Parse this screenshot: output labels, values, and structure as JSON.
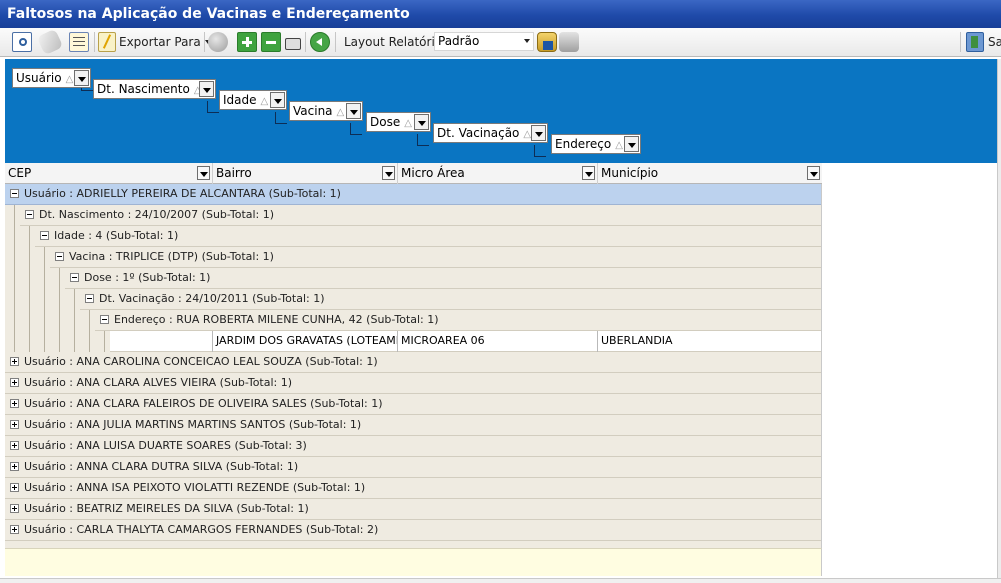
{
  "window": {
    "title": "Faltosos na Aplicação de Vacinas e Endereçamento"
  },
  "toolbar": {
    "export_label": "Exportar Para",
    "layout_label": "Layout Relatório",
    "layout_value": "Padrão",
    "right_button_label": "Sa",
    "icons": [
      "preview-icon",
      "eraser-icon",
      "edit-icon",
      "export-icon",
      "circle-icon",
      "expand-icon",
      "collapse-icon",
      "print-icon",
      "refresh-icon",
      "save-layout-icon",
      "delete-layout-icon",
      "exit-icon"
    ]
  },
  "group_panel": {
    "chips": [
      {
        "label": "Usuário",
        "sort": "△"
      },
      {
        "label": "Dt. Nascimento",
        "sort": "△"
      },
      {
        "label": "Idade",
        "sort": "△"
      },
      {
        "label": "Vacina",
        "sort": "△"
      },
      {
        "label": "Dose",
        "sort": "△"
      },
      {
        "label": "Dt. Vacinação",
        "sort": "△"
      },
      {
        "label": "Endereço",
        "sort": "△"
      }
    ]
  },
  "columns": [
    "CEP",
    "Bairro",
    "Micro Área",
    "Município"
  ],
  "tree": {
    "expanded": [
      "Usuário : ADRIELLY PEREIRA DE ALCANTARA (Sub-Total: 1)",
      "Dt. Nascimento : 24/10/2007 (Sub-Total: 1)",
      "Idade : 4 (Sub-Total: 1)",
      "Vacina : TRIPLICE (DTP) (Sub-Total: 1)",
      "Dose : 1º (Sub-Total: 1)",
      "Dt. Vacinação : 24/10/2011 (Sub-Total: 1)",
      "Endereço : RUA ROBERTA MILENE CUNHA, 42  (Sub-Total: 1)"
    ],
    "data_row": {
      "cep": "",
      "bairro": "JARDIM DOS GRAVATAS (LOTEAMENT",
      "micro_area": "MICROAREA 06",
      "municipio": "UBERLANDIA"
    },
    "collapsed": [
      "Usuário : ANA CAROLINA CONCEICAO LEAL SOUZA (Sub-Total: 1)",
      "Usuário : ANA CLARA ALVES VIEIRA (Sub-Total: 1)",
      "Usuário : ANA CLARA FALEIROS DE OLIVEIRA SALES (Sub-Total: 1)",
      "Usuário : ANA JULIA MARTINS MARTINS SANTOS (Sub-Total: 1)",
      "Usuário : ANA LUISA DUARTE SOARES (Sub-Total: 3)",
      "Usuário : ANNA CLARA DUTRA SILVA (Sub-Total: 1)",
      "Usuário : ANNA ISA PEIXOTO VIOLATTI REZENDE (Sub-Total: 1)",
      "Usuário : BEATRIZ MEIRELES DA SILVA (Sub-Total: 1)",
      "Usuário : CARLA THALYTA CAMARGOS FERNANDES (Sub-Total: 2)"
    ]
  },
  "colors": {
    "title_bar": "#1f4aa9",
    "group_panel": "#0a75c2",
    "selected_row": "#bcd2ee",
    "grid_bg": "#efebe1",
    "footer": "#fffde1"
  }
}
